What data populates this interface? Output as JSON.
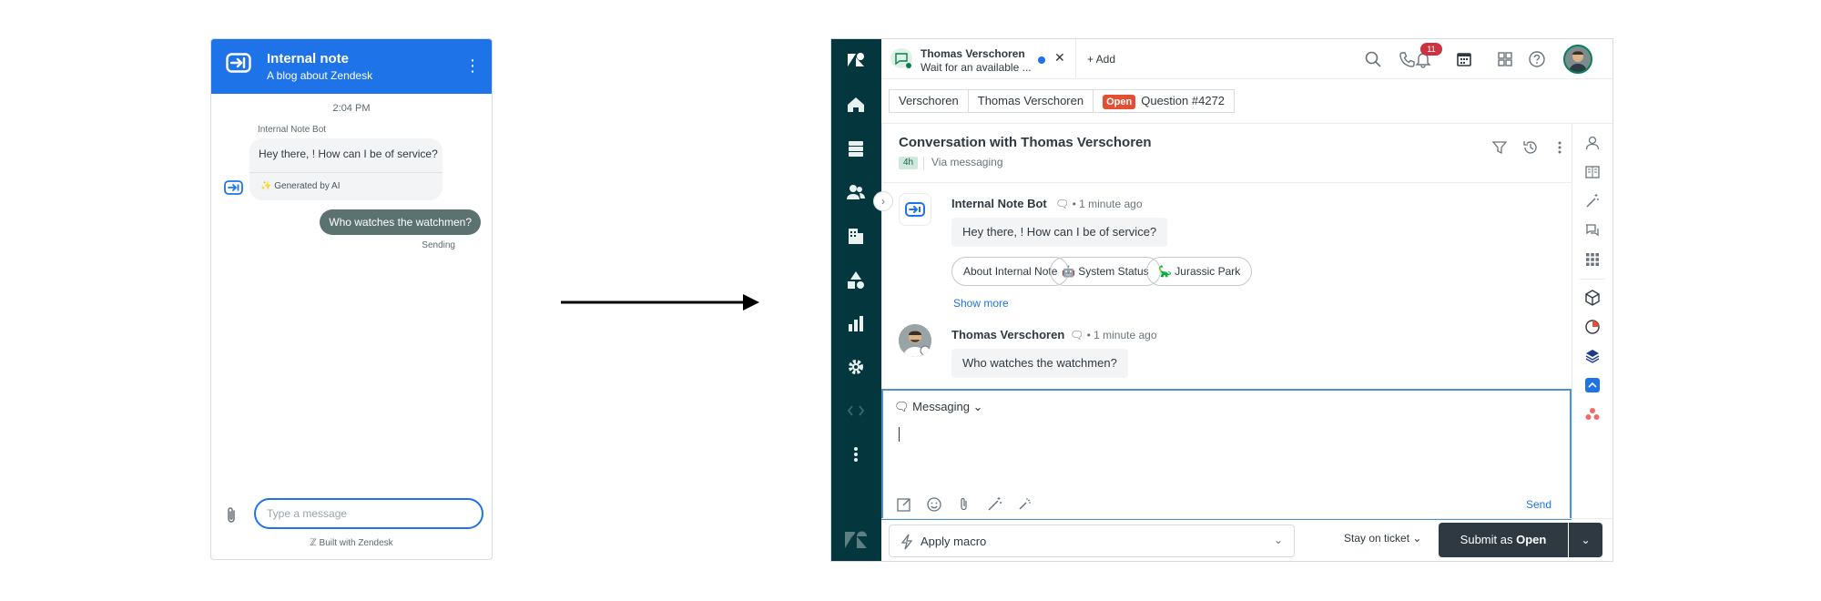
{
  "widget": {
    "header_title": "Internal note",
    "header_subtitle": "A blog about Zendesk",
    "timestamp": "2:04 PM",
    "bot_name": "Internal Note Bot",
    "bot_message": "Hey there, ! How can I be of service?",
    "generated_label": "Generated by AI",
    "user_message": "Who watches the watchmen?",
    "sending_status": "Sending",
    "input_placeholder": "Type a message",
    "built_with": "Built with Zendesk",
    "header_color": "#1f73e8"
  },
  "workspace": {
    "tab": {
      "name": "Thomas Verschoren",
      "status": "Wait for an available ...",
      "add_label": "+ Add"
    },
    "notification_count": "11",
    "breadcrumbs": {
      "org": "Verschoren",
      "requester": "Thomas Verschoren",
      "status_badge": "Open",
      "ticket": "Question #4272"
    },
    "conversation": {
      "title": "Conversation with Thomas Verschoren",
      "age": "4h",
      "channel_via": "Via messaging",
      "bot_name": "Internal Note Bot",
      "bot_time": "1 minute ago",
      "bot_message": "Hey there, ! How can I be of service?",
      "chips": [
        "About Internal Note",
        "🤖 System Status",
        "🦕 Jurassic Park"
      ],
      "show_more": "Show more",
      "user_name": "Thomas Verschoren",
      "user_time": "1 minute ago",
      "user_message": "Who watches the watchmen?",
      "separator": "•"
    },
    "composer": {
      "channel": "Messaging",
      "send_label": "Send"
    },
    "footer": {
      "macro_label": "Apply macro",
      "stay_label": "Stay on ticket",
      "submit_prefix": "Submit as ",
      "submit_status": "Open"
    },
    "colors": {
      "nav_bg": "#03363d",
      "status_open": "#e34f32",
      "submit_bg": "#2f3941",
      "link": "#1f73e8"
    }
  },
  "icons": {
    "nav": [
      "zendesk-logo-icon",
      "home-icon",
      "views-icon",
      "customers-icon",
      "organizations-icon",
      "objects-icon",
      "reporting-icon",
      "admin-gear-icon",
      "dev-icon",
      "more-icon",
      "zendesk-wordmark-icon"
    ],
    "right_sidebar": [
      "user-profile-icon",
      "knowledge-icon",
      "ai-wand-icon",
      "side-conversations-icon",
      "apps-icon",
      "cube-app-icon",
      "pie-app-icon",
      "layers-app-icon",
      "blue-app-icon",
      "asana-app-icon"
    ]
  }
}
